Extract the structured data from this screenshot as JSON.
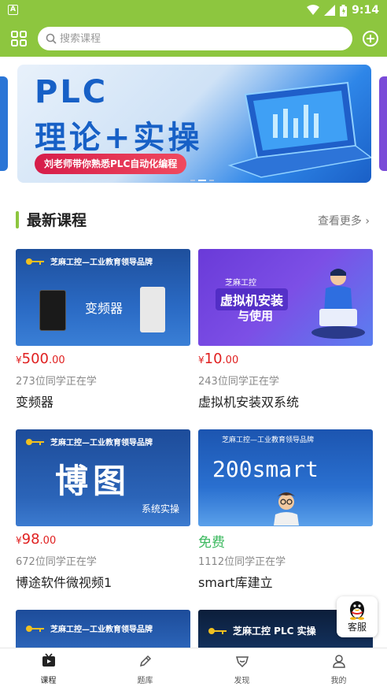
{
  "status_bar": {
    "time": "9:14",
    "icons": [
      "app-notification-icon",
      "wifi-icon",
      "signal-icon",
      "battery-icon"
    ]
  },
  "header": {
    "menu_icon": "grid-menu-icon",
    "search_placeholder": "搜索课程",
    "search_icon": "search-icon",
    "add_icon": "plus-circle-icon"
  },
  "banner": {
    "line1": "PLC",
    "line2": "理论+实操",
    "subtitle": "刘老师带你熟悉PLC自动化编程"
  },
  "section": {
    "title": "最新课程",
    "more_label": "查看更多",
    "more_icon": "chevron-right-icon"
  },
  "courses": [
    {
      "thumb_brand": "芝麻工控—工业教育领导品牌",
      "thumb_text": "变频器",
      "price_yen": "¥",
      "price_int": "500",
      "price_dec": ".00",
      "learners": "273位同学正在学",
      "name": "变频器"
    },
    {
      "thumb_brand": "芝麻工控",
      "thumb_text": "虚拟机安装",
      "thumb_text2": "与使用",
      "price_yen": "¥",
      "price_int": "10",
      "price_dec": ".00",
      "learners": "243位同学正在学",
      "name": "虚拟机安装双系统"
    },
    {
      "thumb_brand": "芝麻工控—工业教育领导品牌",
      "thumb_text": "博图",
      "thumb_text2": "系统实操",
      "price_yen": "¥",
      "price_int": "98",
      "price_dec": ".00",
      "learners": "672位同学正在学",
      "name": "博途软件微视频1"
    },
    {
      "thumb_brand": "芝麻工控—工业教育领导品牌",
      "thumb_text": "200smart",
      "price_free": "免费",
      "learners": "1112位同学正在学",
      "name": "smart库建立"
    },
    {
      "thumb_brand": "芝麻工控—工业教育领导品牌"
    },
    {
      "thumb_brand": "芝麻工控 PLC 实操"
    }
  ],
  "kefu": {
    "label": "客服",
    "icon": "qq-penguin-icon"
  },
  "tabs": [
    {
      "label": "课程",
      "icon": "play-tv-icon",
      "active": true
    },
    {
      "label": "题库",
      "icon": "pencil-icon",
      "active": false
    },
    {
      "label": "发现",
      "icon": "discover-shield-icon",
      "active": false
    },
    {
      "label": "我的",
      "icon": "user-icon",
      "active": false
    }
  ],
  "colors": {
    "brand_green": "#8dc63f",
    "price_red": "#e02020",
    "free_green": "#3cb95f"
  }
}
